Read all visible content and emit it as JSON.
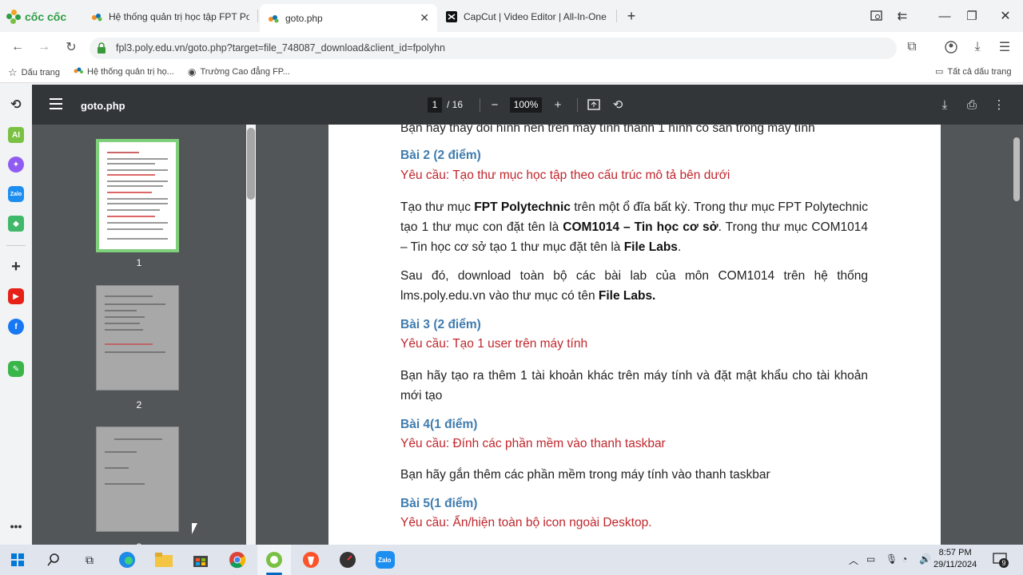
{
  "browser": {
    "brand": "cốc cốc",
    "tabs": [
      {
        "title": "Hệ thống quản trị học tập FPT Pol",
        "active": false
      },
      {
        "title": "goto.php",
        "active": true
      },
      {
        "title": "CapCut | Video Editor | All-In-One",
        "active": false
      }
    ],
    "url": "fpl3.poly.edu.vn/goto.php?target=file_748087_download&client_id=fpolyhn",
    "bookmarks": [
      {
        "label": "Dấu trang"
      },
      {
        "label": "Hệ thống quản trị họ..."
      },
      {
        "label": "Trường Cao đẳng FP..."
      }
    ],
    "all_bookmarks": "Tất cả dấu trang"
  },
  "pdf": {
    "title": "goto.php",
    "page_current": "1",
    "page_total": "/ 16",
    "zoom": "100%",
    "thumbnails": [
      "1",
      "2",
      "3"
    ],
    "content": {
      "top_cut": "Bạn hãy thay đổi hình nền trên máy tính thành 1 hình có sẵn trong máy tính",
      "bai2_heading": "Bài 2 (2 điểm)",
      "bai2_req": "Yêu cầu: Tạo thư mục học tập theo cấu trúc mô tả bên dưới",
      "bai2_p1_a": "Tạo thư mục ",
      "bai2_p1_b": "FPT Polytechnic",
      "bai2_p1_c": " trên một ổ đĩa bất kỳ. Trong thư mục FPT Polytechnic tạo 1 thư mục con đặt tên là ",
      "bai2_p1_d": "COM1014 – Tin học cơ sở",
      "bai2_p1_e": ". Trong thư mục COM1014 – Tin học cơ sở tạo 1 thư mục đặt tên là ",
      "bai2_p1_f": "File Labs",
      "bai2_p1_g": ".",
      "bai2_p2_a": "Sau đó, download toàn bộ các bài lab của môn COM1014 trên hệ thống lms.poly.edu.vn vào thư mục có tên ",
      "bai2_p2_b": "File Labs.",
      "bai3_heading": "Bài 3 (2 điểm)",
      "bai3_req": "Yêu cầu: Tạo 1 user trên máy tính",
      "bai3_p": "Bạn hãy tạo ra thêm 1 tài khoản khác trên máy tính và đặt mật khẩu cho tài khoản mới tạo",
      "bai4_heading": "Bài 4(1 điểm)",
      "bai4_req": "Yêu cầu: Ðính các phần mềm vào thanh taskbar",
      "bai4_p": "Bạn hãy gắn thêm các phần mềm trong máy tính vào thanh taskbar",
      "bai5_heading": "Bài 5(1 điểm)",
      "bai5_req": "Yêu cầu: Ẩn/hiện toàn bộ icon ngoài Desktop."
    }
  },
  "taskbar": {
    "time": "8:57 PM",
    "date": "29/11/2024",
    "notif_count": "9"
  },
  "colors": {
    "heading": "#3f7cae",
    "requirement": "#c0272d",
    "pdf_toolbar": "#323639",
    "pdf_bg": "#525659"
  }
}
